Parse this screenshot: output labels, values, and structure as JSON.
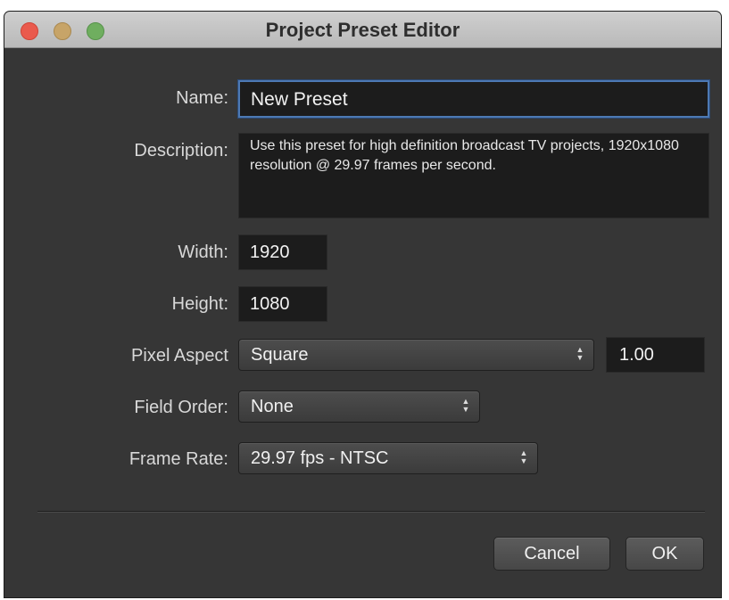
{
  "window": {
    "title": "Project Preset Editor"
  },
  "form": {
    "name_label": "Name:",
    "name_value": "New Preset",
    "description_label": "Description:",
    "description_value": "Use this preset for high definition broadcast TV projects, 1920x1080 resolution @ 29.97 frames per second.",
    "width_label": "Width:",
    "width_value": "1920",
    "height_label": "Height:",
    "height_value": "1080",
    "pixel_aspect_label": "Pixel Aspect",
    "pixel_aspect_selected": "Square",
    "pixel_aspect_value": "1.00",
    "field_order_label": "Field Order:",
    "field_order_selected": "None",
    "frame_rate_label": "Frame Rate:",
    "frame_rate_selected": "29.97 fps - NTSC"
  },
  "buttons": {
    "cancel_label": "Cancel",
    "ok_label": "OK"
  },
  "icons": {
    "close": "close-icon",
    "minimize": "minimize-icon",
    "zoom": "zoom-icon",
    "stepper": "up-down-chevron-icon"
  },
  "colors": {
    "window_bg": "#363636",
    "focus_ring": "#4d79b3",
    "close": "#ea5a4d",
    "minimize": "#c7a468",
    "zoom": "#6fae5f"
  }
}
